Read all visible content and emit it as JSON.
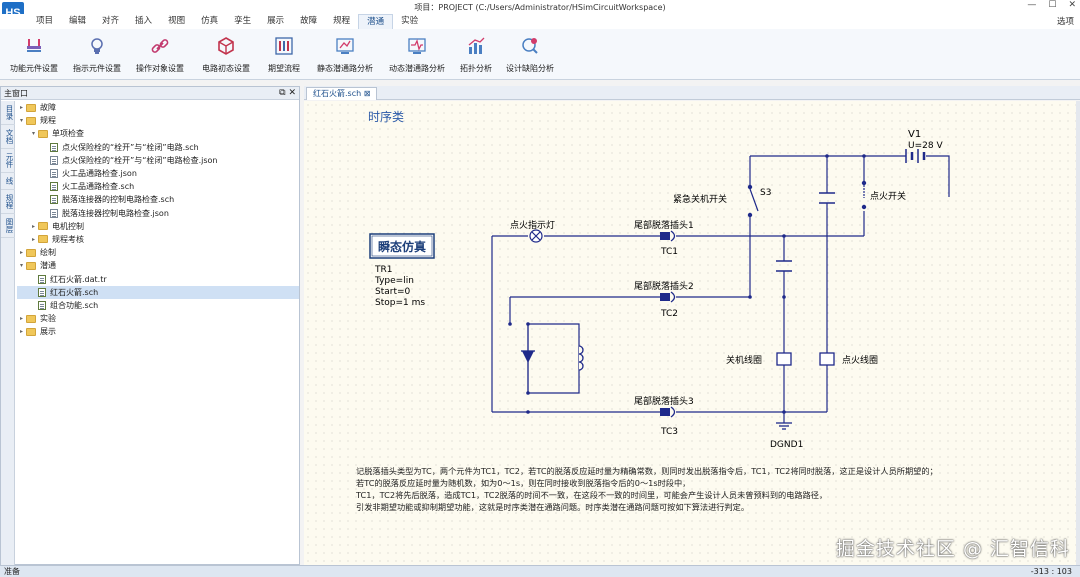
{
  "window": {
    "title": "项目：PROJECT (C:/Users/Administrator/HSimCircuitWorkspace)",
    "logo": "HS"
  },
  "menu": {
    "tabs": [
      "项目",
      "编辑",
      "对齐",
      "插入",
      "视图",
      "仿真",
      "孪生",
      "展示",
      "故障",
      "规程",
      "潜通",
      "实验"
    ],
    "active_index": 10,
    "options_label": "选项"
  },
  "ribbon": {
    "buttons": [
      {
        "label": "功能元件设置",
        "icon": "component-settings-icon"
      },
      {
        "label": "指示元件设置",
        "icon": "indicator-settings-icon"
      },
      {
        "label": "操作对象设置",
        "icon": "link-icon"
      },
      {
        "label": "电路初态设置",
        "icon": "cube-icon"
      },
      {
        "label": "期望流程",
        "icon": "sliders-icon"
      },
      {
        "label": "静态潜通路分析",
        "icon": "static-analysis-icon"
      },
      {
        "label": "动态潜通路分析",
        "icon": "dynamic-analysis-icon"
      },
      {
        "label": "拓扑分析",
        "icon": "bar-chart-icon"
      },
      {
        "label": "设计缺陷分析",
        "icon": "defect-analysis-icon"
      }
    ]
  },
  "left_panel": {
    "title": "主窗口",
    "vertical_tabs": [
      "目录",
      "文档",
      "元件",
      "线",
      "规程",
      "图层"
    ],
    "tree": [
      {
        "label": "故障",
        "level": 0,
        "type": "folder",
        "expanded": false
      },
      {
        "label": "规程",
        "level": 0,
        "type": "folder",
        "expanded": true
      },
      {
        "label": "单项检查",
        "level": 1,
        "type": "folder",
        "expanded": true
      },
      {
        "label": "点火保险栓的“栓开”与“栓闭”电路.sch",
        "level": 2,
        "type": "file-pen"
      },
      {
        "label": "点火保险栓的“栓开”与“栓闭”电路检查.json",
        "level": 2,
        "type": "file"
      },
      {
        "label": "火工品通路检查.json",
        "level": 2,
        "type": "file"
      },
      {
        "label": "火工品通路检查.sch",
        "level": 2,
        "type": "file-pen"
      },
      {
        "label": "脱落连接器的控制电路检查.sch",
        "level": 2,
        "type": "file-pen"
      },
      {
        "label": "脱落连接器控制电路检查.json",
        "level": 2,
        "type": "file"
      },
      {
        "label": "电机控制",
        "level": 1,
        "type": "folder",
        "expanded": false
      },
      {
        "label": "规程考核",
        "level": 1,
        "type": "folder",
        "expanded": false
      },
      {
        "label": "绘制",
        "level": 0,
        "type": "folder",
        "expanded": false
      },
      {
        "label": "潜通",
        "level": 0,
        "type": "folder",
        "expanded": true
      },
      {
        "label": "红石火箭.dat.tr",
        "level": 1,
        "type": "file-pen"
      },
      {
        "label": "红石火箭.sch",
        "level": 1,
        "type": "file-pen",
        "selected": true
      },
      {
        "label": "组合功能.sch",
        "level": 1,
        "type": "file-pen"
      },
      {
        "label": "实验",
        "level": 0,
        "type": "folder",
        "expanded": false
      },
      {
        "label": "展示",
        "level": 0,
        "type": "folder",
        "expanded": false
      }
    ]
  },
  "document_tab": {
    "label": "红石火箭.sch ⊠"
  },
  "schematic": {
    "heading": "时序类",
    "sim_box_title": "瞬态仿真",
    "sim_params": [
      "TR1",
      "Type=lin",
      "Start=0",
      "Stop=1 ms"
    ],
    "labels": {
      "source_name": "V1",
      "source_value": "U=28 V",
      "emergency_switch": "紧急关机开关",
      "s3": "S3",
      "ignition_switch": "点火开关",
      "ignition_lamp": "点火指示灯",
      "plug1": "尾部脱落插头1",
      "tc1": "TC1",
      "plug2": "尾部脱落插头2",
      "tc2": "TC2",
      "plug3": "尾部脱落插头3",
      "tc3": "TC3",
      "shutdown_coil": "关机线圈",
      "ignition_coil": "点火线圈",
      "ground": "DGND1"
    },
    "description": [
      "记脱落插头类型为TC，两个元件为TC1，TC2，若TC的脱落反应延时量为精确常数，则同时发出脱落指令后，TC1，TC2将同时脱落，这正是设计人员所期望的；",
      "若TC的脱落反应延时量为随机数，如为0～1s，则在同时接收到脱落指令后的0～1s时段中，",
      "TC1，TC2将先后脱落，造成TC1，TC2脱落的时间不一致，在这段不一致的时间里，可能会产生设计人员未曾预料到的电路路径，",
      "引发非期望功能或抑制期望功能，这就是时序类潜在通路问题。时序类潜在通路问题可按如下算法进行判定。"
    ]
  },
  "status": {
    "left": "准备",
    "right": "-313 : 103"
  },
  "watermark": "掘金技术社区 @ 汇智信科"
}
